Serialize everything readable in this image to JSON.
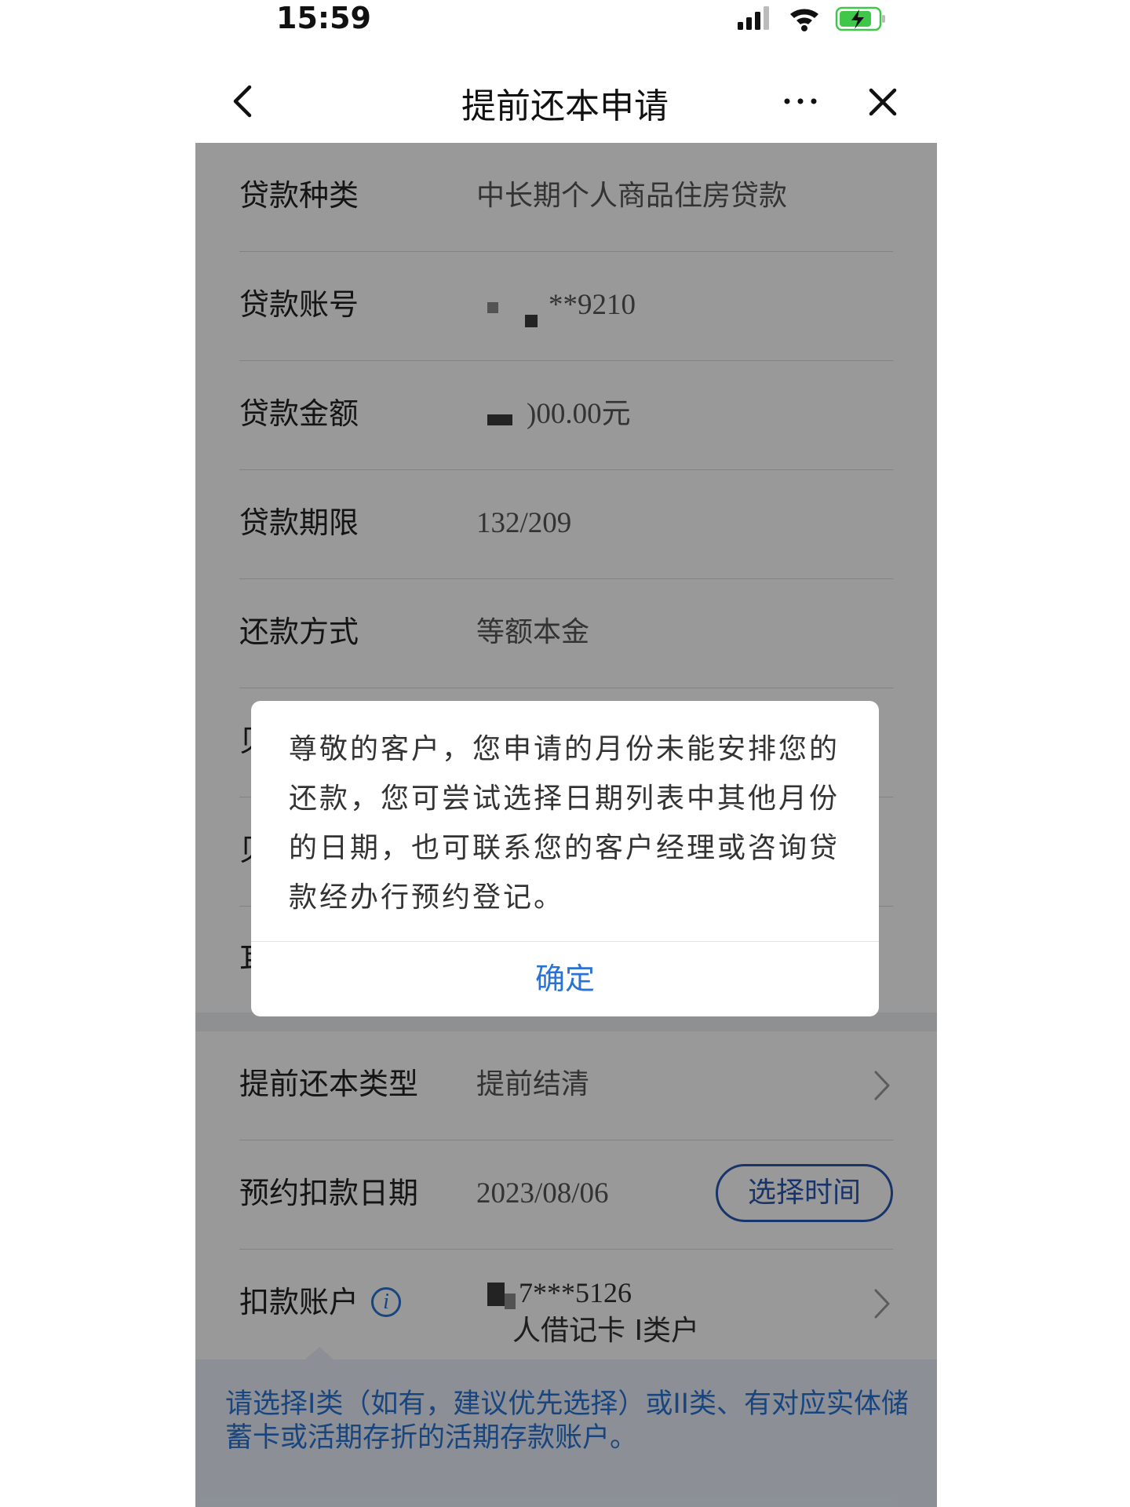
{
  "status_bar": {
    "time": "15:59"
  },
  "nav": {
    "title": "提前还本申请"
  },
  "loan_info": [
    {
      "label": "贷款种类",
      "value": "中长期个人商品住房贷款"
    },
    {
      "label": "贷款账号",
      "value": "**9210"
    },
    {
      "label": "贷款金额",
      "value": ")00.00元"
    },
    {
      "label": "贷款期限",
      "value": "132/209"
    },
    {
      "label": "还款方式",
      "value": "等额本金"
    },
    {
      "label": "贝"
    },
    {
      "label": "贝"
    },
    {
      "label": "耳"
    }
  ],
  "prepay": {
    "type_label": "提前还本类型",
    "type_value": "提前结清",
    "date_label": "预约扣款日期",
    "date_value": "2023/08/06",
    "date_button": "选择时间",
    "account_label": "扣款账户",
    "account_number": "7***5126",
    "account_type": "人借记卡 I类户",
    "info_icon_glyph": "i"
  },
  "tooltip": {
    "text": "请选择I类（如有，建议优先选择）或II类、有对应实体储蓄卡或活期存折的活期存款账户。"
  },
  "dialog": {
    "message": "尊敬的客户，您申请的月份未能安排您的还款，您可尝试选择日期列表中其他月份的日期，也可联系您的客户经理或咨询贷款经办行预约登记。",
    "confirm_label": "确定"
  },
  "colors": {
    "accent": "#2a73d4",
    "button_border": "#2a58b2",
    "battery": "#3fc74a"
  }
}
